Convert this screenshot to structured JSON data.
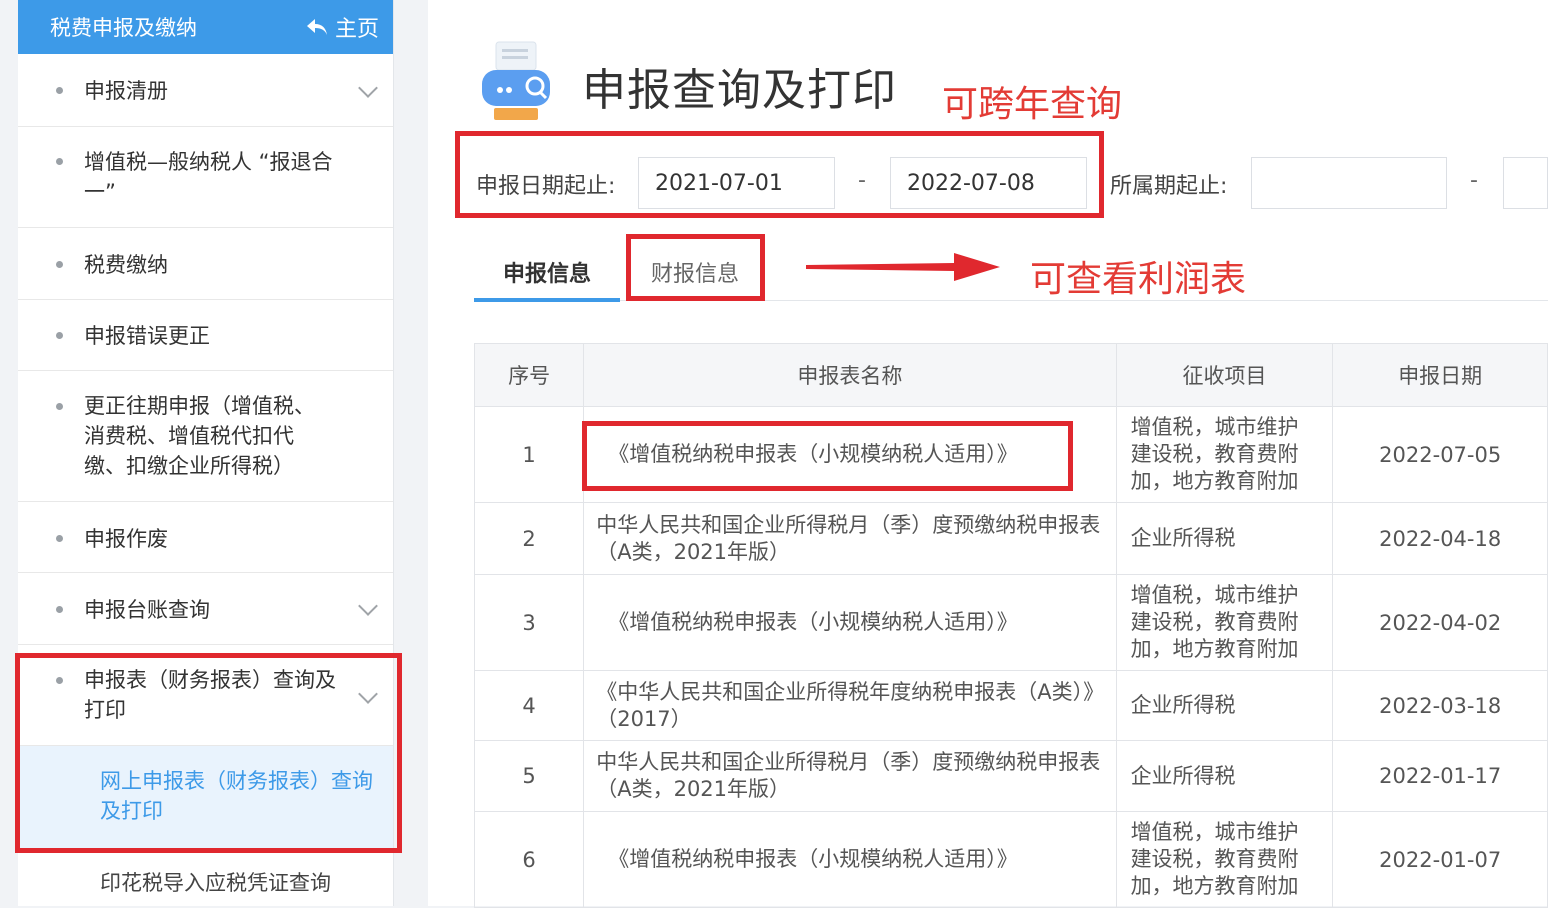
{
  "sidebar": {
    "header_title": "税费申报及缴纳",
    "home_label": "主页",
    "items": [
      {
        "label": "申报清册"
      },
      {
        "label": "增值税—般纳税人 “报退合一”"
      },
      {
        "label": "税费缴纳"
      },
      {
        "label": "申报错误更正"
      },
      {
        "label": "更正往期申报（增值税、消费税、增值税代扣代缴、扣缴企业所得税）"
      },
      {
        "label": "申报作废"
      },
      {
        "label": "申报台账查询"
      },
      {
        "label": "申报表（财务报表）查询及打印"
      }
    ],
    "sub_items": [
      {
        "label": "网上申报表（财务报表）查询及打印"
      },
      {
        "label": "印花税导入应税凭证查询"
      }
    ]
  },
  "page": {
    "title": "申报查询及打印",
    "annotation_cross_year": "可跨年查询",
    "annotation_profit": "可查看利润表"
  },
  "filters": {
    "date_label": "申报日期起止:",
    "date_from": "2021-07-01",
    "separator": "-",
    "date_to": "2022-07-08",
    "period_label": "所属期起止:",
    "period_from": "",
    "period_to": ""
  },
  "tabs": [
    {
      "label": "申报信息",
      "active": true
    },
    {
      "label": "财报信息",
      "active": false
    }
  ],
  "table": {
    "headers": [
      "序号",
      "申报表名称",
      "征收项目",
      "申报日期"
    ],
    "rows": [
      {
        "no": "1",
        "name": "《增值税纳税申报表（小规模纳税人适用）》",
        "item": "增值税，城市维护建设税，教育费附加，地方教育附加",
        "date": "2022-07-05"
      },
      {
        "no": "2",
        "name": "中华人民共和国企业所得税月（季）度预缴纳税申报表（A类，2021年版）",
        "item": "企业所得税",
        "date": "2022-04-18"
      },
      {
        "no": "3",
        "name": "《增值税纳税申报表（小规模纳税人适用）》",
        "item": "增值税，城市维护建设税，教育费附加，地方教育附加",
        "date": "2022-04-02"
      },
      {
        "no": "4",
        "name": "《中华人民共和国企业所得税年度纳税申报表（A类）》（2017）",
        "item": "企业所得税",
        "date": "2022-03-18"
      },
      {
        "no": "5",
        "name": "中华人民共和国企业所得税月（季）度预缴纳税申报表（A类，2021年版）",
        "item": "企业所得税",
        "date": "2022-01-17"
      },
      {
        "no": "6",
        "name": "《增值税纳税申报表（小规模纳税人适用）》",
        "item": "增值税，城市维护建设税，教育费附加，地方教育附加",
        "date": "2022-01-07"
      }
    ]
  },
  "colors": {
    "accent": "#3d9ae8",
    "annotation_red": "#e0282e"
  }
}
